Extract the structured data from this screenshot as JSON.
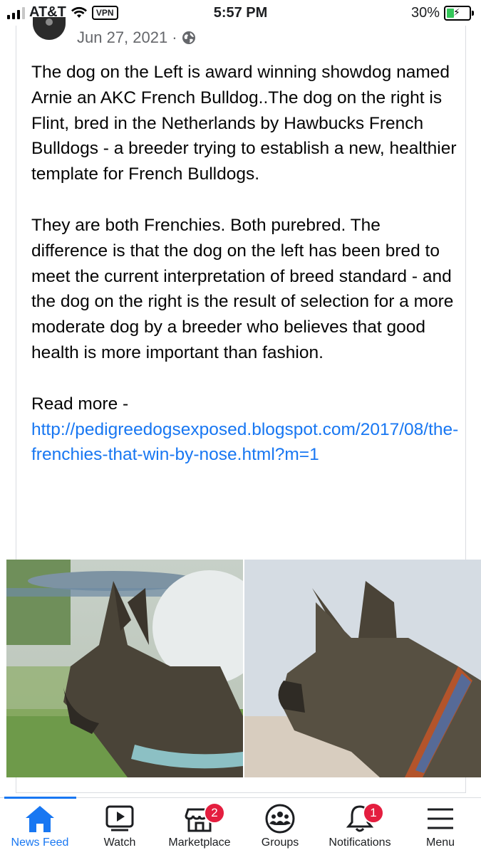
{
  "status_bar": {
    "carrier": "AT&T",
    "vpn": "VPN",
    "time": "5:57 PM",
    "battery": "30%"
  },
  "post": {
    "date": "Jun 27, 2021",
    "separator": "·",
    "paragraph1": "The dog on the Left is award winning showdog named Arnie an AKC French Bulldog..The dog on the right is Flint, bred in the Netherlands by Hawbucks French Bulldogs - a breeder trying to establish a new, healthier template for French Bulldogs.",
    "paragraph2": "They are both Frenchies. Both purebred. The difference is that the dog on the left has been bred to meet the current interpretation of breed standard - and the dog on the right is the result of selection for a more moderate dog by a breeder who believes that good health is more important than fashion.",
    "read_more": "Read more -",
    "link": "http://pedigreedogsexposed.blogspot.com/2017/08/the-frenchies-that-win-by-nose.html?m=1"
  },
  "bottom_nav": {
    "tabs": [
      {
        "label": "News Feed",
        "icon": "home-icon",
        "active": true
      },
      {
        "label": "Watch",
        "icon": "watch-icon"
      },
      {
        "label": "Marketplace",
        "icon": "marketplace-icon",
        "badge": "2"
      },
      {
        "label": "Groups",
        "icon": "groups-icon"
      },
      {
        "label": "Notifications",
        "icon": "bell-icon",
        "badge": "1"
      },
      {
        "label": "Menu",
        "icon": "menu-icon"
      }
    ]
  },
  "colors": {
    "accent": "#1877f2",
    "badge": "#e41e3f",
    "meta_text": "#65676b"
  }
}
